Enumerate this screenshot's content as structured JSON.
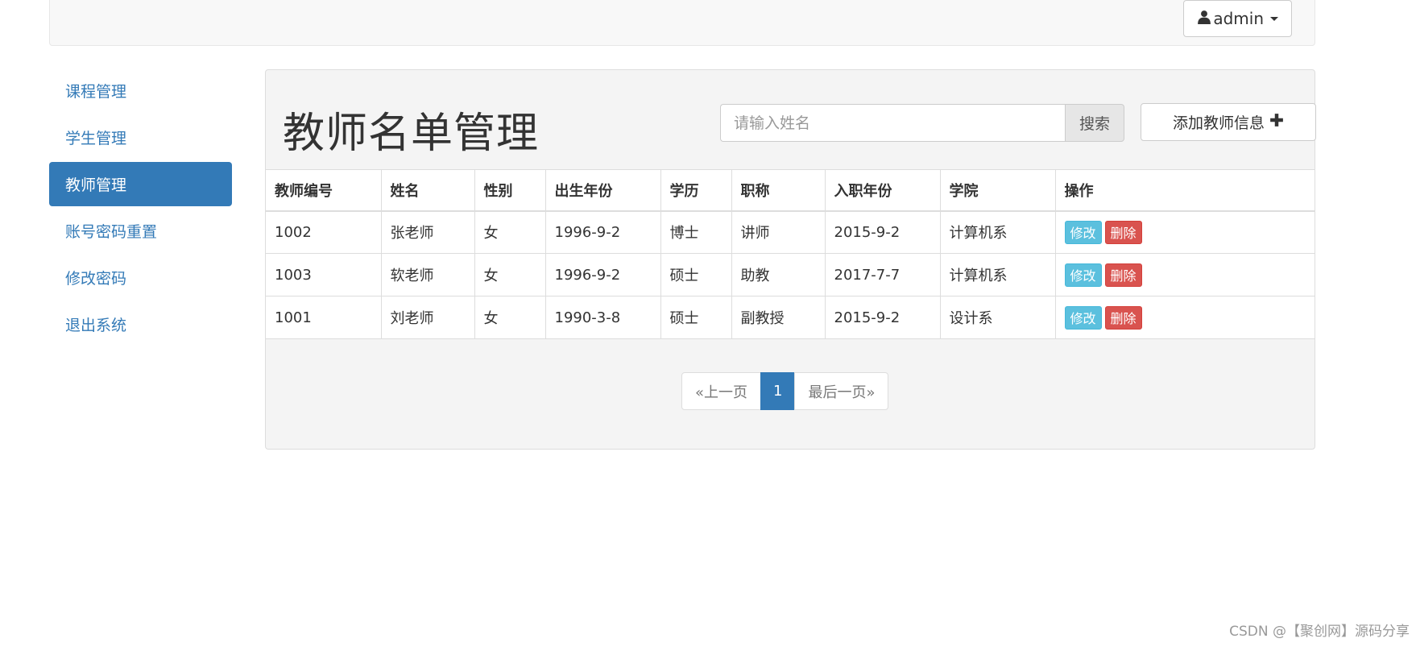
{
  "navbar": {
    "user_label": "admin"
  },
  "sidebar": {
    "items": [
      {
        "label": "课程管理"
      },
      {
        "label": "学生管理"
      },
      {
        "label": "教师管理"
      },
      {
        "label": "账号密码重置"
      },
      {
        "label": "修改密码"
      },
      {
        "label": "退出系统"
      }
    ],
    "active_index": 2
  },
  "main": {
    "title": "教师名单管理",
    "search": {
      "placeholder": "请输入姓名",
      "value": "",
      "button_label": "搜索"
    },
    "add_button_label": "添加教师信息",
    "table": {
      "columns": [
        "教师编号",
        "姓名",
        "性别",
        "出生年份",
        "学历",
        "职称",
        "入职年份",
        "学院",
        "操作"
      ],
      "rows": [
        {
          "id": "1002",
          "name": "张老师",
          "gender": "女",
          "birth": "1996-9-2",
          "degree": "博士",
          "title": "讲师",
          "hire": "2015-9-2",
          "college": "计算机系",
          "edit_label": "修改",
          "delete_label": "删除"
        },
        {
          "id": "1003",
          "name": "软老师",
          "gender": "女",
          "birth": "1996-9-2",
          "degree": "硕士",
          "title": "助教",
          "hire": "2017-7-7",
          "college": "计算机系",
          "edit_label": "修改",
          "delete_label": "删除"
        },
        {
          "id": "1001",
          "name": "刘老师",
          "gender": "女",
          "birth": "1990-3-8",
          "degree": "硕士",
          "title": "副教授",
          "hire": "2015-9-2",
          "college": "设计系",
          "edit_label": "修改",
          "delete_label": "删除"
        }
      ]
    },
    "pagination": {
      "prev_label": "«上一页",
      "current_page": "1",
      "last_label": "最后一页»"
    }
  },
  "watermark": "CSDN @【聚创网】源码分享",
  "colors": {
    "primary": "#337ab7",
    "info": "#5bc0de",
    "danger": "#d9534f",
    "navbar_bg": "#f8f8f8",
    "panel_bg": "#f4f4f4"
  }
}
